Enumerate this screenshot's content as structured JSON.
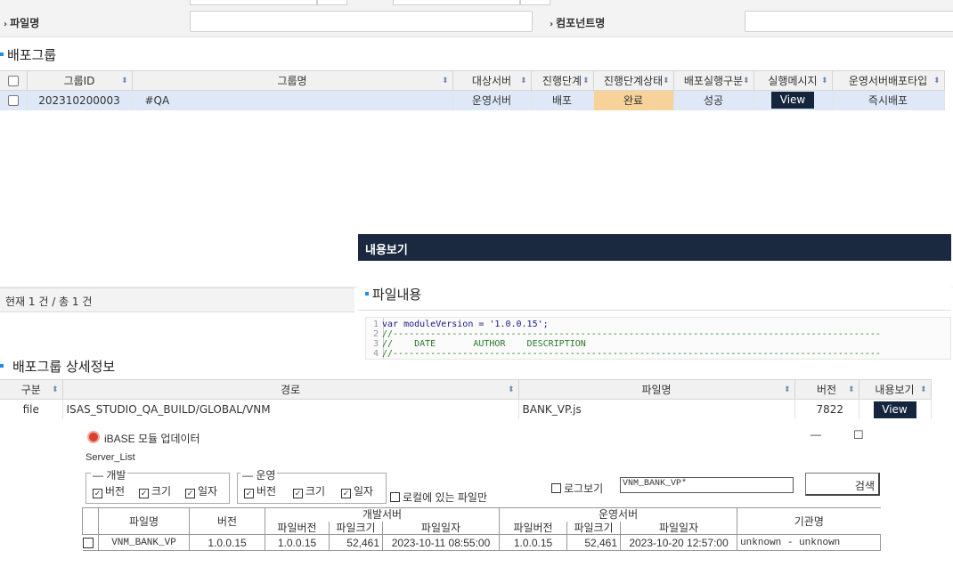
{
  "search": {
    "file_label": "파일명",
    "component_label": "컴포넌트명",
    "file_value": "",
    "component_value": ""
  },
  "group": {
    "title": "배포그룹",
    "headers": [
      "그룹ID",
      "그룹명",
      "대상서버",
      "진행단계",
      "진행단계상태",
      "배포실행구분",
      "실행메시지",
      "운영서버배포타입"
    ],
    "row": {
      "id": "202310200003",
      "name": "#QA",
      "server": "운영서버",
      "stage": "배포",
      "stage_status": "완료",
      "exec_type": "성공",
      "message_btn": "View",
      "deploy_type": "즉시배포"
    },
    "footer": "현재 1 건 / 총 1 건"
  },
  "popup": {
    "title": "내용보기",
    "file_content_title": "파일내용",
    "code_lines": [
      {
        "n": "1",
        "t": "var moduleVersion = '1.0.0.15';"
      },
      {
        "n": "2",
        "t": "//-------------------------------------------------------------------------------------------"
      },
      {
        "n": "3",
        "t": "//    DATE       AUTHOR    DESCRIPTION"
      },
      {
        "n": "4",
        "t": "//-------------------------------------------------------------------------------------------"
      }
    ]
  },
  "detail": {
    "title": "배포그룹 상세정보",
    "headers": [
      "구분",
      "경로",
      "파일명",
      "버전",
      "내용보기"
    ],
    "row": {
      "type": "file",
      "path": "ISAS_STUDIO_QA_BUILD/GLOBAL/VNM",
      "filename": "BANK_VP.js",
      "version": "7822",
      "view_btn": "View"
    }
  },
  "updater": {
    "title": "iBASE 모듈 업데이터",
    "minimize": "—",
    "maximize": "☐",
    "server_list": "Server_List",
    "dev_legend": "개발",
    "ops_legend": "운영",
    "opt_version": "버전",
    "opt_size": "크기",
    "opt_date": "일자",
    "local_only": "로컬에 있는 파일만",
    "log_view": "로그보기",
    "search_value": "VNM_BANK_VP*",
    "search_btn": "검색",
    "col_filename": "파일명",
    "col_version": "버전",
    "dev_group": "개발서버",
    "ops_group": "운영서버",
    "col_file_version": "파일버전",
    "col_file_size": "파일크기",
    "col_file_date": "파일일자",
    "col_org": "기관명",
    "row": {
      "filename": "VNM_BANK_VP",
      "version": "1.0.0.15",
      "dev_version": "1.0.0.15",
      "dev_size": "52,461",
      "dev_date": "2023-10-11 08:55:00",
      "ops_version": "1.0.0.15",
      "ops_size": "52,461",
      "ops_date": "2023-10-20 12:57:00",
      "org": "unknown - unknown"
    }
  }
}
